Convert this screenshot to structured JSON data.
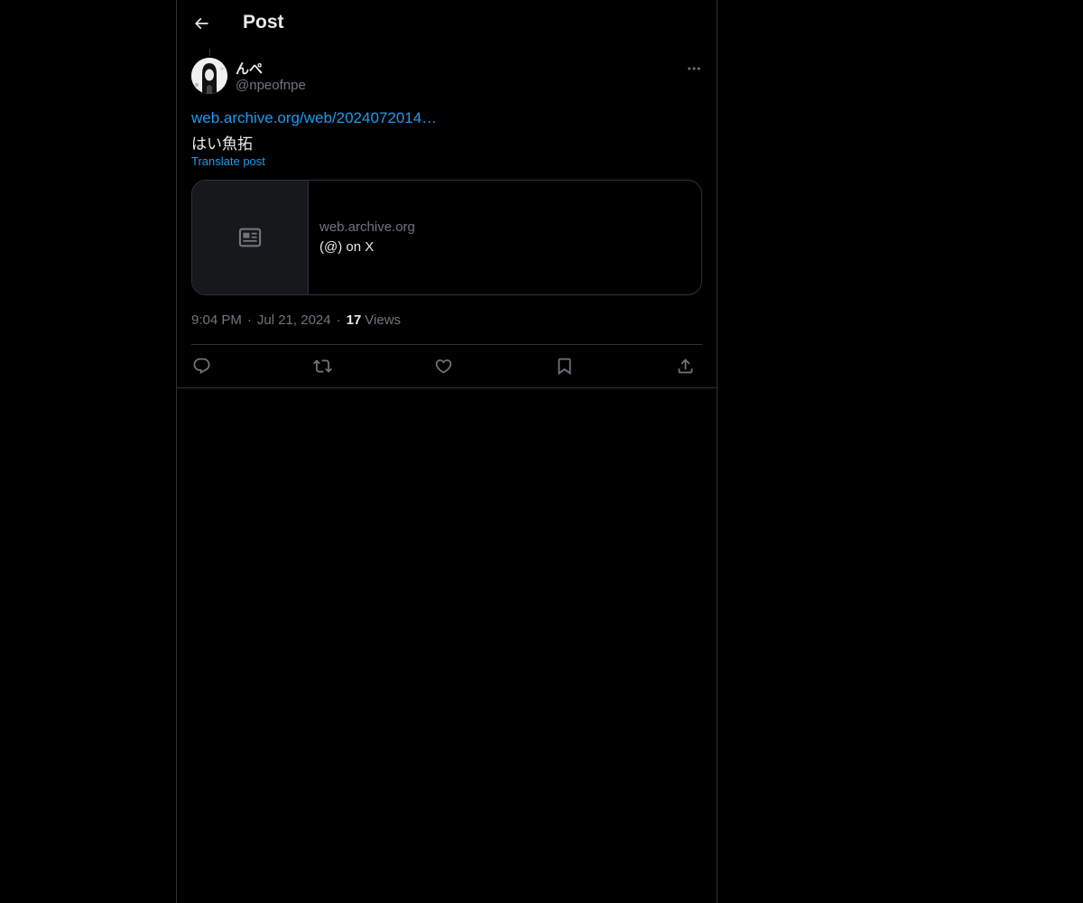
{
  "header": {
    "title": "Post"
  },
  "post": {
    "author": {
      "display_name": "んぺ",
      "handle": "@npeofnpe"
    },
    "link_text": "web.archive.org/web/2024072014…",
    "text": "はい魚拓",
    "translate_label": "Translate post",
    "card": {
      "domain": "web.archive.org",
      "title": "(@) on X"
    },
    "meta": {
      "time": "9:04 PM",
      "separator": "·",
      "date": "Jul 21, 2024",
      "views_count": "17",
      "views_label": "Views"
    }
  },
  "colors": {
    "background": "#000000",
    "text_primary": "#e7e9ea",
    "text_secondary": "#71767b",
    "accent": "#1d9bf0",
    "border": "#2f3336"
  },
  "icons": {
    "back": "arrow-left-icon",
    "more": "more-horizontal-icon",
    "card_placeholder": "article-icon",
    "reply": "reply-icon",
    "repost": "repost-icon",
    "like": "heart-icon",
    "bookmark": "bookmark-icon",
    "share": "share-icon"
  }
}
